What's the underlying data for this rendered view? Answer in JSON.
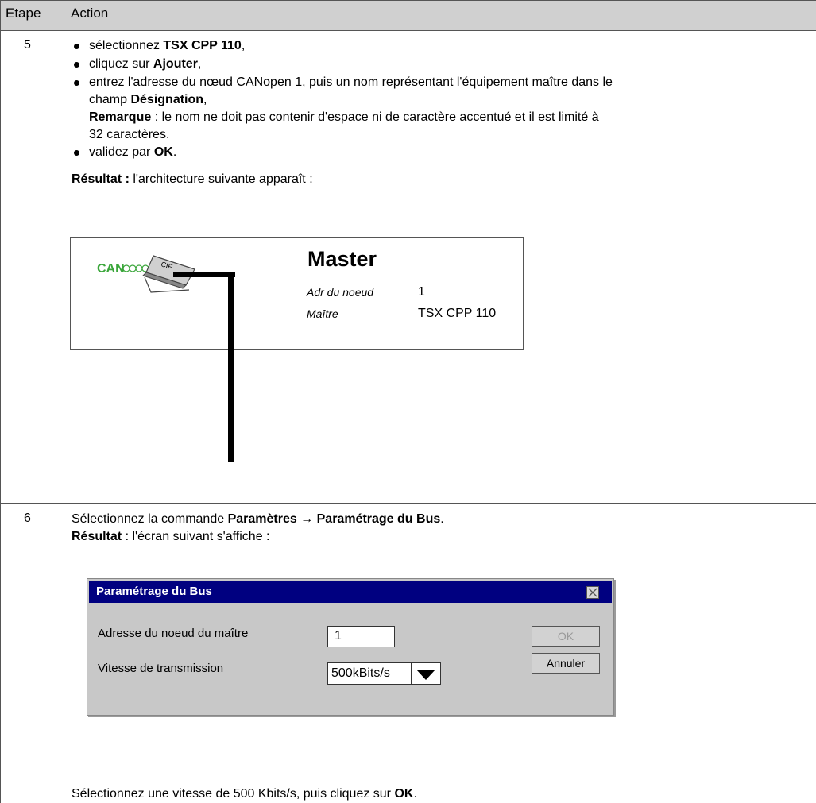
{
  "header": {
    "col_step": "Etape",
    "col_action": "Action"
  },
  "row5": {
    "step": "5",
    "bullets": [
      {
        "pre": "sélectionnez ",
        "bold": "TSX CPP 110",
        "post": ","
      },
      {
        "pre": "cliquez sur ",
        "bold": "Ajouter",
        "post": ","
      },
      {
        "line1": "entrez l'adresse du nœud CANopen 1, puis un nom représentant l'équipement maître dans le",
        "line2_pre": "champ ",
        "line2_bold": "Désignation",
        "line2_post": ",",
        "remark_bold": "Remarque",
        "remark_line1": " : le nom ne doit pas contenir d'espace ni de caractère accentué et il est limité à",
        "remark_line2": "32 caractères."
      },
      {
        "pre": "validez par ",
        "bold": "OK",
        "post": "."
      }
    ],
    "result_bold": "Résultat :",
    "result_text": " l'architecture suivante apparaît :",
    "diagram": {
      "can_label": "CAN",
      "card_label": "CIF",
      "title": "Master",
      "addr_label": "Adr du noeud",
      "addr_value": "1",
      "master_label": "Maître",
      "master_value": "TSX CPP 110"
    }
  },
  "row6": {
    "step": "6",
    "line1_pre": "Sélectionnez la commande ",
    "line1_bold": "Paramètres → Paramétrage du Bus",
    "line1_post": ".",
    "result_bold": "Résultat",
    "result_text": " : l'écran suivant s'affiche :",
    "dialog": {
      "title": "Paramétrage du Bus",
      "addr_label": "Adresse du noeud du maître",
      "addr_value": "1",
      "speed_label": "Vitesse de transmission",
      "speed_value": "500kBits/s",
      "ok_label": "OK",
      "cancel_label": "Annuler"
    },
    "final_pre": "Sélectionnez une vitesse de 500 Kbits/s, puis cliquez sur ",
    "final_bold": "OK",
    "final_post": "."
  }
}
